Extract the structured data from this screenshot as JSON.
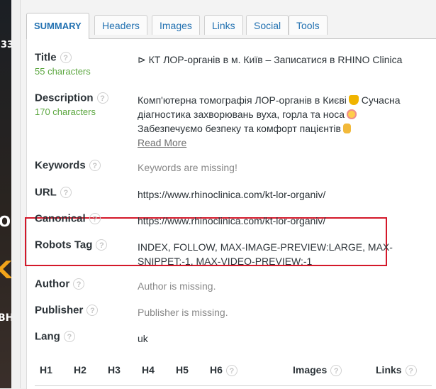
{
  "background_strip": {
    "texts": [
      "33",
      "O",
      "K",
      "ВН"
    ]
  },
  "tabs": [
    {
      "label": "SUMMARY",
      "active": true
    },
    {
      "label": "Headers",
      "active": false
    },
    {
      "label": "Images",
      "active": false
    },
    {
      "label": "Links",
      "active": false
    },
    {
      "label": "Social",
      "active": false
    },
    {
      "label": "Tools",
      "active": false
    }
  ],
  "summary": {
    "title": {
      "label": "Title",
      "count": "55 characters",
      "value": "⊳ КТ ЛОР-органів в м. Київ – Записатися в RHINO Clinica"
    },
    "description": {
      "label": "Description",
      "count": "170 characters",
      "line1": "Комп'ютерна томографія ЛОР-органів в Києві",
      "line1b": "Сучасна",
      "line2": "діагностика захворювань вуха, горла та носа",
      "line3": "Забезпечуємо безпеку та комфорт пацієнтів",
      "read_more": "Read More"
    },
    "keywords": {
      "label": "Keywords",
      "value": "Keywords are missing!"
    },
    "url": {
      "label": "URL",
      "value": "https://www.rhinoclinica.com/kt-lor-organiv/"
    },
    "canonical": {
      "label": "Canonical",
      "value": "https://www.rhinoclinica.com/kt-lor-organiv/"
    },
    "robots": {
      "label": "Robots Tag",
      "line1": "INDEX, FOLLOW, MAX-IMAGE-PREVIEW:LARGE, MAX-",
      "line2": "SNIPPET:-1, MAX-VIDEO-PREVIEW:-1"
    },
    "author": {
      "label": "Author",
      "value": "Author is missing."
    },
    "publisher": {
      "label": "Publisher",
      "value": "Publisher is missing."
    },
    "lang": {
      "label": "Lang",
      "value": "uk"
    }
  },
  "headings_bar": {
    "h1": "H1",
    "h2": "H2",
    "h3": "H3",
    "h4": "H4",
    "h5": "H5",
    "h6": "H6",
    "images": "Images",
    "links": "Links"
  },
  "colors": {
    "accent": "#2271b1",
    "count_green": "#5ca740",
    "highlight_red": "#d4182a"
  },
  "icons": {
    "help": "question-circle-icon",
    "emoji_heart": "yellow-heart-emoji",
    "emoji_face": "smiling-face-emoji",
    "emoji_hand": "pointing-down-hand-emoji"
  }
}
